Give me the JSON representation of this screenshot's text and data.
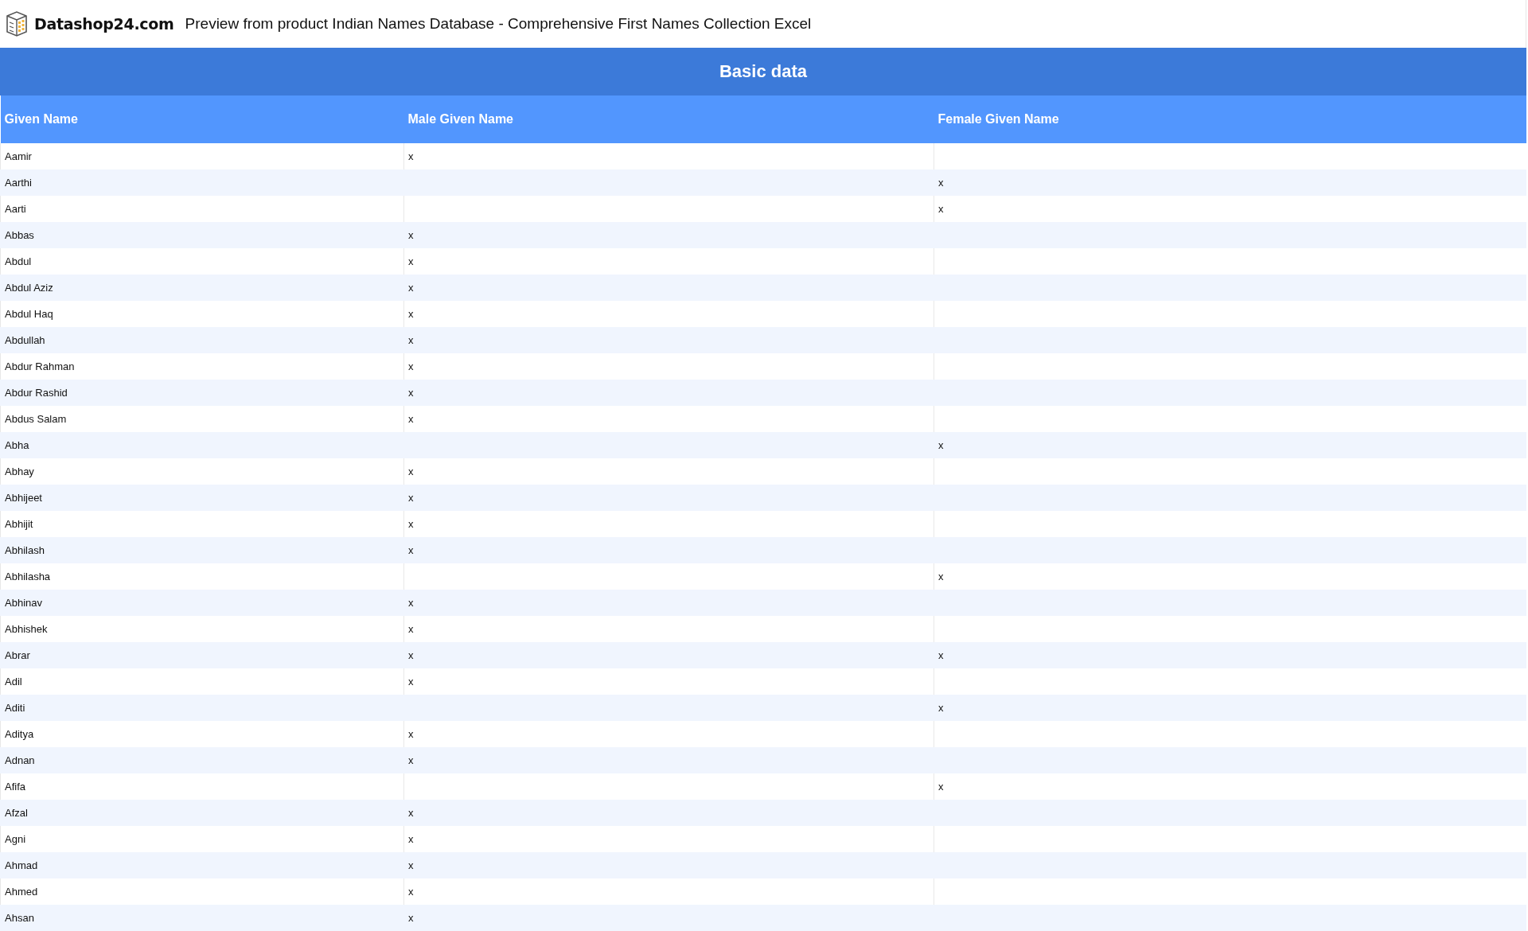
{
  "header": {
    "logo_text": "Datashop24.com",
    "title": "Preview from product Indian Names Database - Comprehensive First Names Collection Excel"
  },
  "table": {
    "group_heading": "Basic data",
    "columns": [
      "Given Name",
      "Male Given Name",
      "Female Given Name"
    ],
    "rows": [
      [
        "Aamir",
        "x",
        ""
      ],
      [
        "Aarthi",
        "",
        "x"
      ],
      [
        "Aarti",
        "",
        "x"
      ],
      [
        "Abbas",
        "x",
        ""
      ],
      [
        "Abdul",
        "x",
        ""
      ],
      [
        "Abdul Aziz",
        "x",
        ""
      ],
      [
        "Abdul Haq",
        "x",
        ""
      ],
      [
        "Abdullah",
        "x",
        ""
      ],
      [
        "Abdur Rahman",
        "x",
        ""
      ],
      [
        "Abdur Rashid",
        "x",
        ""
      ],
      [
        "Abdus Salam",
        "x",
        ""
      ],
      [
        "Abha",
        "",
        "x"
      ],
      [
        "Abhay",
        "x",
        ""
      ],
      [
        "Abhijeet",
        "x",
        ""
      ],
      [
        "Abhijit",
        "x",
        ""
      ],
      [
        "Abhilash",
        "x",
        ""
      ],
      [
        "Abhilasha",
        "",
        "x"
      ],
      [
        "Abhinav",
        "x",
        ""
      ],
      [
        "Abhishek",
        "x",
        ""
      ],
      [
        "Abrar",
        "x",
        "x"
      ],
      [
        "Adil",
        "x",
        ""
      ],
      [
        "Aditi",
        "",
        "x"
      ],
      [
        "Aditya",
        "x",
        ""
      ],
      [
        "Adnan",
        "x",
        ""
      ],
      [
        "Afifa",
        "",
        "x"
      ],
      [
        "Afzal",
        "x",
        ""
      ],
      [
        "Agni",
        "x",
        ""
      ],
      [
        "Ahmad",
        "x",
        ""
      ],
      [
        "Ahmed",
        "x",
        ""
      ],
      [
        "Ahsan",
        "x",
        ""
      ]
    ]
  }
}
